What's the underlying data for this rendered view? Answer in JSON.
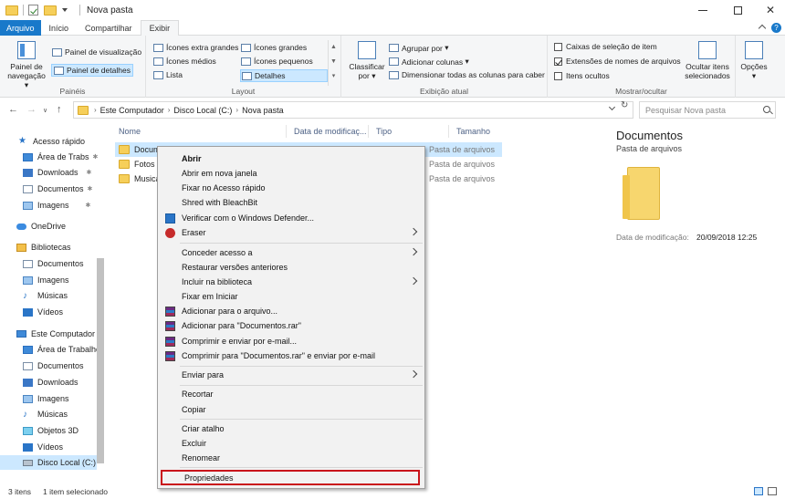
{
  "window": {
    "title": "Nova pasta"
  },
  "tabs": [
    {
      "label": "Arquivo"
    },
    {
      "label": "Início"
    },
    {
      "label": "Compartilhar"
    },
    {
      "label": "Exibir"
    }
  ],
  "ribbon": {
    "painel_nav_label": "Painel de navegação",
    "painel_visualizacao": "Painel de visualização",
    "painel_detalhes": "Painel de detalhes",
    "group_paineis": "Painéis",
    "layout": {
      "icones_extra_grandes": "Ícones extra grandes",
      "icones_grandes": "Ícones grandes",
      "icones_medios": "Ícones médios",
      "icones_pequenos": "Ícones pequenos",
      "lista": "Lista",
      "detalhes": "Detalhes"
    },
    "group_layout": "Layout",
    "classificar_por": "Classificar por",
    "agrupar_por": "Agrupar por",
    "adicionar_colunas": "Adicionar colunas",
    "dimensionar": "Dimensionar todas as colunas para caber",
    "group_exibicao": "Exibição atual",
    "caixas_selecao": "Caixas de seleção de item",
    "extensoes": "Extensões de nomes de arquivos",
    "itens_ocultos": "Itens ocultos",
    "ocultar_itens": "Ocultar itens selecionados",
    "group_mostrar": "Mostrar/ocultar",
    "opcoes": "Opções"
  },
  "address": {
    "crumbs": [
      "Este Computador",
      "Disco Local (C:)",
      "Nova pasta"
    ],
    "search_placeholder": "Pesquisar Nova pasta"
  },
  "nav": {
    "acesso_rapido": "Acesso rápido",
    "area_trabalho_quick": "Área de Trabs",
    "downloads_quick": "Downloads",
    "documentos_quick": "Documentos",
    "imagens_quick": "Imagens",
    "onedrive": "OneDrive",
    "bibliotecas": "Bibliotecas",
    "lib_documentos": "Documentos",
    "lib_imagens": "Imagens",
    "lib_musicas": "Músicas",
    "lib_videos": "Vídeos",
    "este_computador": "Este Computador",
    "pc_area_trabalho": "Área de Trabalho",
    "pc_documentos": "Documentos",
    "pc_downloads": "Downloads",
    "pc_imagens": "Imagens",
    "pc_musicas": "Músicas",
    "pc_objetos": "Objetos 3D",
    "pc_videos": "Vídeos",
    "pc_disco": "Disco Local (C:)"
  },
  "filelist": {
    "columns": {
      "nome": "Nome",
      "data": "Data de modificaç...",
      "tipo": "Tipo",
      "tamanho": "Tamanho"
    },
    "rows": [
      {
        "name": "Documentos",
        "type": "Pasta de arquivos"
      },
      {
        "name": "Fotos",
        "type": "Pasta de arquivos"
      },
      {
        "name": "Musica",
        "type": "Pasta de arquivos"
      }
    ]
  },
  "details": {
    "title": "Documentos",
    "subtitle": "Pasta de arquivos",
    "date_label": "Data de modificação:",
    "date_value": "20/09/2018 12:25"
  },
  "status": {
    "count": "3 itens",
    "selected": "1 item selecionado"
  },
  "context_menu": {
    "abrir": "Abrir",
    "abrir_nova_janela": "Abrir em nova janela",
    "fixar_acesso": "Fixar no Acesso rápido",
    "shred": "Shred with BleachBit",
    "defender": "Verificar com o Windows Defender...",
    "eraser": "Eraser",
    "conceder": "Conceder acesso a",
    "restaurar": "Restaurar versões anteriores",
    "incluir": "Incluir na biblioteca",
    "fixar_iniciar": "Fixar em Iniciar",
    "add_arquivo": "Adicionar para o arquivo...",
    "add_rar": "Adicionar para \"Documentos.rar\"",
    "comprimir_email": "Comprimir e enviar por e-mail...",
    "comprimir_rar_email": "Comprimir para \"Documentos.rar\" e enviar por e-mail",
    "enviar_para": "Enviar para",
    "recortar": "Recortar",
    "copiar": "Copiar",
    "criar_atalho": "Criar atalho",
    "excluir": "Excluir",
    "renomear": "Renomear",
    "propriedades": "Propriedades"
  },
  "colors": {
    "accent": "#1979ca",
    "selection": "#cce8ff",
    "highlight_border": "#c9141b"
  }
}
